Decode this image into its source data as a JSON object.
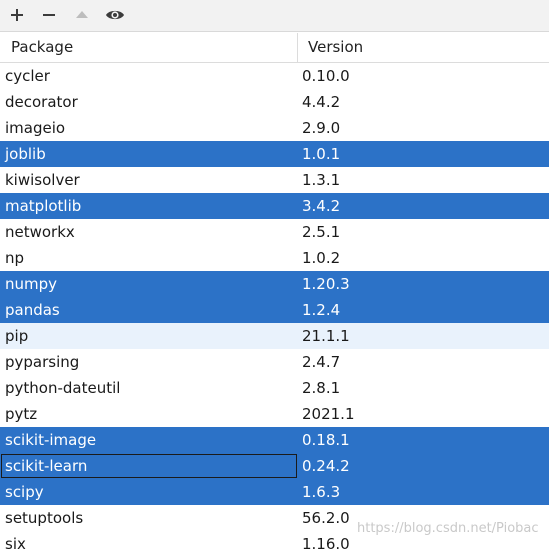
{
  "toolbar": {
    "buttons": [
      {
        "icon": "plus-icon",
        "enabled": true
      },
      {
        "icon": "minus-icon",
        "enabled": true
      },
      {
        "icon": "up-triangle-icon",
        "enabled": false
      },
      {
        "icon": "eye-icon",
        "enabled": true
      }
    ]
  },
  "table": {
    "columns": [
      "Package",
      "Version"
    ],
    "rows": [
      {
        "name": "cycler",
        "version": "0.10.0",
        "selected": false
      },
      {
        "name": "decorator",
        "version": "4.4.2",
        "selected": false
      },
      {
        "name": "imageio",
        "version": "2.9.0",
        "selected": false
      },
      {
        "name": "joblib",
        "version": "1.0.1",
        "selected": true
      },
      {
        "name": "kiwisolver",
        "version": "1.3.1",
        "selected": false
      },
      {
        "name": "matplotlib",
        "version": "3.4.2",
        "selected": true
      },
      {
        "name": "networkx",
        "version": "2.5.1",
        "selected": false
      },
      {
        "name": "np",
        "version": "1.0.2",
        "selected": false
      },
      {
        "name": "numpy",
        "version": "1.20.3",
        "selected": true
      },
      {
        "name": "pandas",
        "version": "1.2.4",
        "selected": true
      },
      {
        "name": "pip",
        "version": "21.1.1",
        "selected": false,
        "hover": true
      },
      {
        "name": "pyparsing",
        "version": "2.4.7",
        "selected": false
      },
      {
        "name": "python-dateutil",
        "version": "2.8.1",
        "selected": false
      },
      {
        "name": "pytz",
        "version": "2021.1",
        "selected": false
      },
      {
        "name": "scikit-image",
        "version": "0.18.1",
        "selected": true
      },
      {
        "name": "scikit-learn",
        "version": "0.24.2",
        "selected": true,
        "focused": true
      },
      {
        "name": "scipy",
        "version": "1.6.3",
        "selected": true
      },
      {
        "name": "setuptools",
        "version": "56.2.0",
        "selected": false
      },
      {
        "name": "six",
        "version": "1.16.0",
        "selected": false
      }
    ]
  },
  "watermark": "https://blog.csdn.net/Piobac",
  "colors": {
    "selection": "#2c72c7",
    "hover": "#e9f2fc",
    "toolbar": "#f2f2f2"
  }
}
